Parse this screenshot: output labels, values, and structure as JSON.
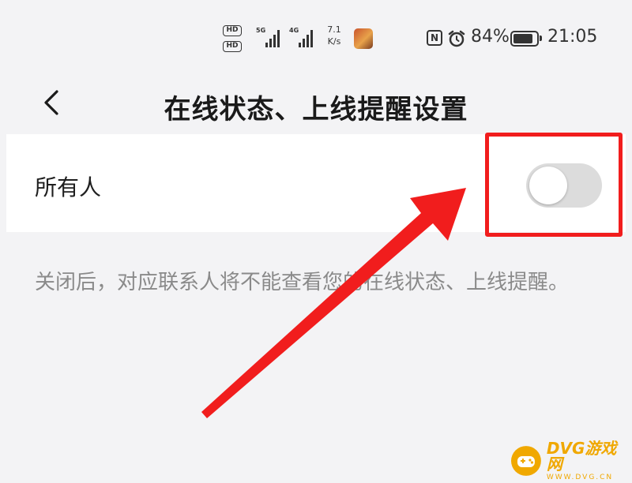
{
  "status_bar": {
    "hd_label": "HD",
    "signal_tag": "5G",
    "signal_tag_2": "4G",
    "speed_value": "7.1",
    "speed_unit": "K/s",
    "nfc_label": "N",
    "battery_percent": "84%",
    "battery_level": 0.84,
    "time": "21:05"
  },
  "header": {
    "back_icon": "chevron-left-icon",
    "title": "在线状态、上线提醒设置"
  },
  "setting": {
    "label": "所有人",
    "toggle_on": false,
    "description": "关闭后，对应联系人将不能查看您的在线状态、上线提醒。"
  },
  "annotation": {
    "highlight_color": "#f11d1d",
    "arrow_color": "#f11d1d"
  },
  "watermark": {
    "name": "DVG游戏网",
    "url": "WWW.DVG.CN",
    "color": "#f0a800"
  }
}
